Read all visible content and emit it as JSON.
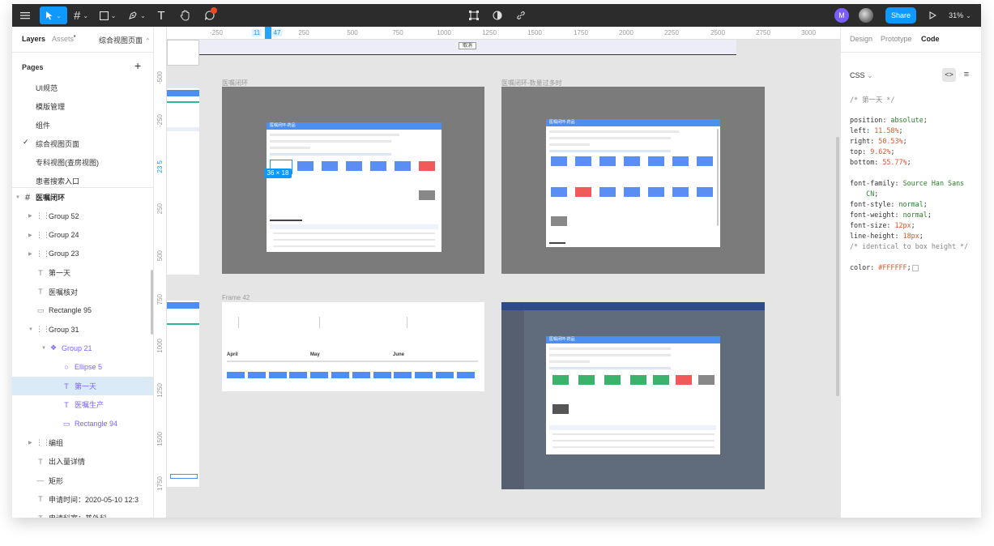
{
  "toolbar": {
    "share_label": "Share",
    "zoom_label": "31%",
    "avatar_initial": "M"
  },
  "left_panel": {
    "tabs": {
      "layers": "Layers",
      "assets": "Assets",
      "page": "综合视图页面"
    },
    "pages_title": "Pages",
    "add_icon": "+",
    "pages": [
      "UI规范",
      "模版管理",
      "组件",
      "综合视图页面",
      "专科视图(查房视图)",
      "患者搜索入口"
    ],
    "current_page_index": 3,
    "layers": [
      {
        "name": "医嘱闭环",
        "icon": "frame-icon",
        "level": 0
      },
      {
        "name": "Group 52",
        "icon": "group-icon",
        "level": 1
      },
      {
        "name": "Group 24",
        "icon": "group-icon",
        "level": 1
      },
      {
        "name": "Group 23",
        "icon": "group-icon",
        "level": 1
      },
      {
        "name": "第一天",
        "icon": "text-icon",
        "level": 1
      },
      {
        "name": "医嘱核对",
        "icon": "text-icon",
        "level": 1
      },
      {
        "name": "Rectangle 95",
        "icon": "rectangle-icon",
        "level": 1
      },
      {
        "name": "Group 31",
        "icon": "group-icon",
        "level": 1
      },
      {
        "name": "Group 21",
        "icon": "component-icon",
        "level": 2
      },
      {
        "name": "Ellipse 5",
        "icon": "ellipse-icon",
        "level": 3
      },
      {
        "name": "第一天",
        "icon": "text-icon",
        "level": 3
      },
      {
        "name": "医嘱生产",
        "icon": "text-icon",
        "level": 3
      },
      {
        "name": "Rectangle 94",
        "icon": "rectangle-icon",
        "level": 3
      },
      {
        "name": "编组",
        "icon": "group-icon",
        "level": 1
      },
      {
        "name": "出入量详情",
        "icon": "text-icon",
        "level": 1
      },
      {
        "name": "矩形",
        "icon": "line-icon",
        "level": 1
      },
      {
        "name": "申请时间：2020-05-10 12:3",
        "icon": "text-icon",
        "level": 1
      },
      {
        "name": "申请科室：普外科",
        "icon": "text-icon",
        "level": 1
      }
    ]
  },
  "rulers": {
    "top": [
      "-250",
      "11",
      "47",
      "250",
      "500",
      "750",
      "1000",
      "1250",
      "1500",
      "1750",
      "2000",
      "2250",
      "2500",
      "2750",
      "3000"
    ],
    "left": [
      "-500",
      "-250",
      "23 5",
      "250",
      "500",
      "750",
      "1000",
      "1250",
      "1500",
      "1750"
    ]
  },
  "canvas": {
    "frames": [
      {
        "label": "医嘱闭环"
      },
      {
        "label": "医嘱闭环-数量过多时"
      },
      {
        "label": "Frame 42"
      },
      {
        "label": ""
      }
    ],
    "dialog_title": "医嘱闭环-药品",
    "selection_size": "36 × 18",
    "top_button": "取消",
    "months": [
      "April",
      "May",
      "June"
    ]
  },
  "right_panel": {
    "tabs": {
      "design": "Design",
      "prototype": "Prototype",
      "code": "Code"
    },
    "language": "CSS",
    "code_lines": [
      {
        "t": "/* 第一天 */",
        "cls": "cm"
      },
      {
        "t": ""
      },
      {
        "t": "position: absolute;",
        "k": "position: ",
        "v": "absolute",
        "vc": "kw"
      },
      {
        "t": "left: 11.58%;",
        "k": "left: ",
        "v": "11.58%",
        "vc": "num"
      },
      {
        "t": "right: 50.53%;",
        "k": "right: ",
        "v": "50.53%",
        "vc": "num"
      },
      {
        "t": "top: 9.62%;",
        "k": "top: ",
        "v": "9.62%",
        "vc": "num"
      },
      {
        "t": "bottom: 55.77%;",
        "k": "bottom: ",
        "v": "55.77%",
        "vc": "num"
      },
      {
        "t": ""
      },
      {
        "t": "font-family: Source Han Sans",
        "k": "font-family: ",
        "v": "Source Han Sans",
        "vc": "kw"
      },
      {
        "t": "    CN;",
        "k": "    ",
        "v": "CN",
        "vc": "kw"
      },
      {
        "t": "font-style: normal;",
        "k": "font-style: ",
        "v": "normal",
        "vc": "kw"
      },
      {
        "t": "font-weight: normal;",
        "k": "font-weight: ",
        "v": "normal",
        "vc": "kw"
      },
      {
        "t": "font-size: 12px;",
        "k": "font-size: ",
        "v": "12px",
        "vc": "num"
      },
      {
        "t": "line-height: 18px;",
        "k": "line-height: ",
        "v": "18px",
        "vc": "num"
      },
      {
        "t": "/* identical to box height */",
        "cls": "cm"
      },
      {
        "t": ""
      },
      {
        "t": "color: #FFFFFF;",
        "k": "color: ",
        "v": "#FFFFFF",
        "vc": "num"
      }
    ]
  },
  "colors": {
    "toolbar_bg": "#2c2c2c",
    "accent": "#0d99ff",
    "component_purple": "#7b61ff",
    "selection_row": "#daebf7",
    "frame_gray": "#7b7b7b",
    "dialog_header": "#4b8ff3"
  }
}
